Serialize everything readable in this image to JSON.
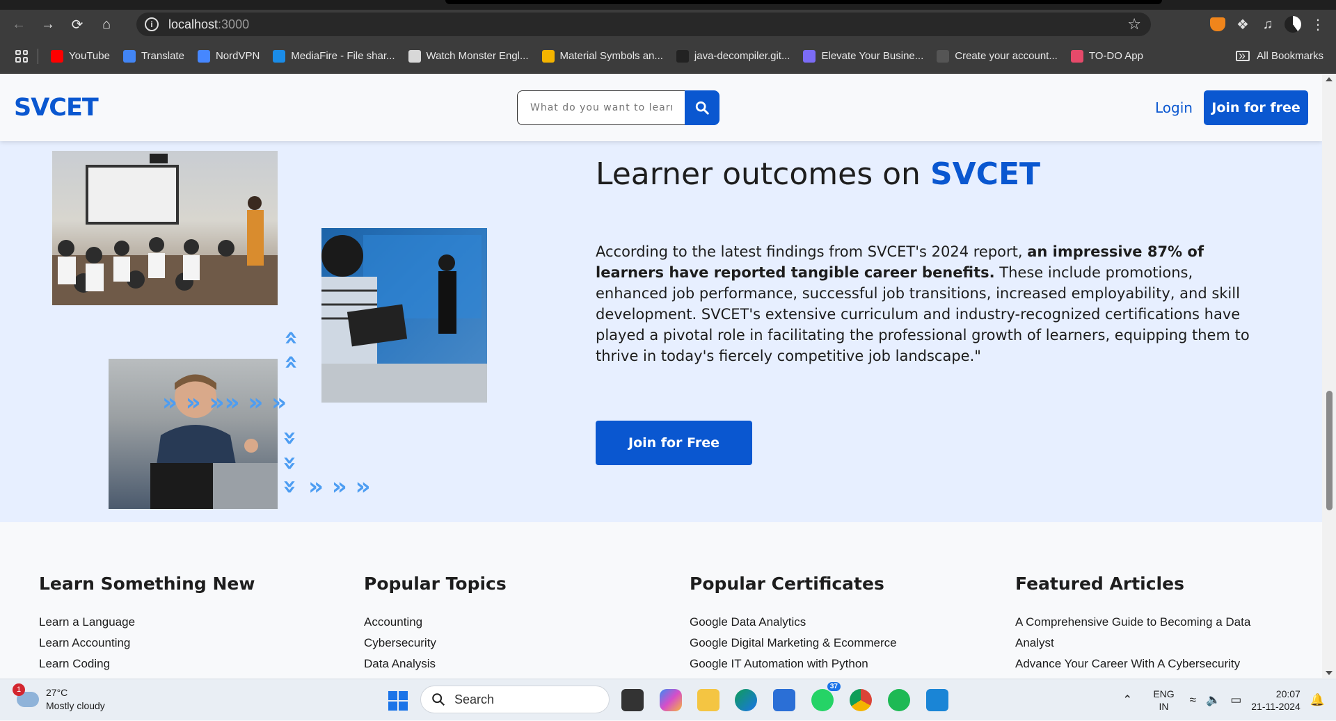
{
  "browser": {
    "url_host": "localhost",
    "url_port": ":3000",
    "bookmarks": [
      {
        "label": "YouTube",
        "color": "#ff0000"
      },
      {
        "label": "Translate",
        "color": "#4285f4"
      },
      {
        "label": "NordVPN",
        "color": "#4687ff"
      },
      {
        "label": "MediaFire - File shar...",
        "color": "#1a8ce8"
      },
      {
        "label": "Watch Monster Engl...",
        "color": "#d8d8d8"
      },
      {
        "label": "Material Symbols an...",
        "color": "#f4b400"
      },
      {
        "label": "java-decompiler.git...",
        "color": "#222222"
      },
      {
        "label": "Elevate Your Busine...",
        "color": "#7b6cf6"
      },
      {
        "label": "Create your account...",
        "color": "#555555"
      },
      {
        "label": "TO-DO App",
        "color": "#e64a6a"
      }
    ],
    "all_bookmarks_label": "All Bookmarks"
  },
  "header": {
    "logo": "SVCET",
    "search_placeholder": "What do you want to learn?",
    "login_label": "Login",
    "join_label": "Join for free"
  },
  "outcomes": {
    "title_prefix": "Learner outcomes on ",
    "title_brand": "SVCET",
    "body_pre": "According to the latest findings from SVCET's 2024 report, ",
    "body_bold": "an impressive 87% of learners have reported tangible career benefits.",
    "body_post": " These include promotions, enhanced job performance, successful job transitions, increased employability, and skill development. SVCET's extensive curriculum and industry-recognized certifications have played a pivotal role in facilitating the professional growth of learners, equipping them to thrive in today's fiercely competitive job landscape.\"",
    "cta_label": "Join for Free"
  },
  "footer": {
    "columns": [
      {
        "heading": "Learn Something New",
        "items": [
          "Learn a Language",
          "Learn Accounting",
          "Learn Coding"
        ]
      },
      {
        "heading": "Popular Topics",
        "items": [
          "Accounting",
          "Cybersecurity",
          "Data Analysis"
        ]
      },
      {
        "heading": "Popular Certificates",
        "items": [
          "Google Data Analytics",
          "Google Digital Marketing & Ecommerce",
          "Google IT Automation with Python"
        ]
      },
      {
        "heading": "Featured Articles",
        "items": [
          "A Comprehensive Guide to Becoming a Data",
          "Analyst",
          "Advance Your Career With A Cybersecurity"
        ]
      }
    ]
  },
  "taskbar": {
    "weather_badge": "1",
    "temperature": "27°C",
    "condition": "Mostly cloudy",
    "search_label": "Search",
    "whatsapp_badge": "37",
    "lang_top": "ENG",
    "lang_bottom": "IN",
    "time": "20:07",
    "date": "21-11-2024"
  },
  "colors": {
    "brand": "#0a57d0",
    "outcomes_bg": "#e7efff",
    "chevron": "#4d9df2"
  }
}
